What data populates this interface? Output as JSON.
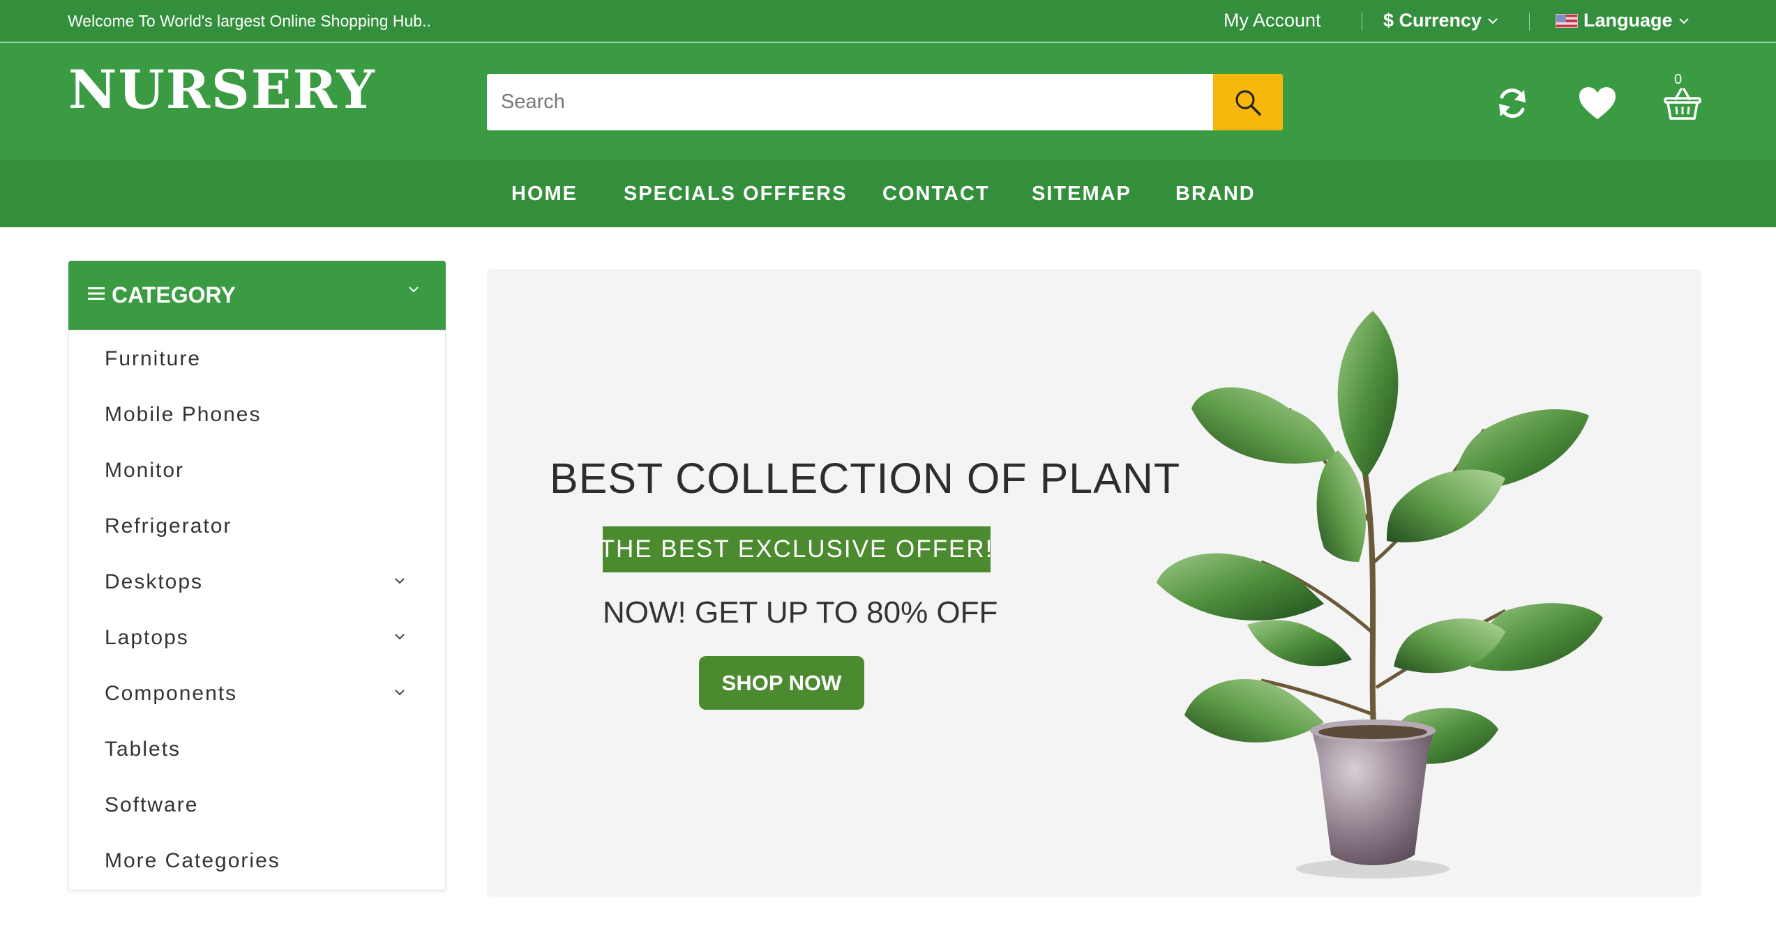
{
  "topbar": {
    "welcome": "Welcome To World's largest Online Shopping Hub..",
    "my_account": "My Account",
    "currency": "$ Currency",
    "language": "Language"
  },
  "header": {
    "logo": "NURSERY",
    "search_placeholder": "Search",
    "cart_count": "0"
  },
  "nav": {
    "items": [
      "HOME",
      "SPECIALS OFFFERS",
      "CONTACT",
      "SITEMAP",
      "BRAND"
    ]
  },
  "sidebar": {
    "title": "CATEGORY",
    "items": [
      {
        "label": "Furniture"
      },
      {
        "label": "Mobile Phones"
      },
      {
        "label": "Monitor"
      },
      {
        "label": "Refrigerator"
      },
      {
        "label": "Desktops",
        "has_submenu": true
      },
      {
        "label": "Laptops",
        "has_submenu": true
      },
      {
        "label": "Components",
        "has_submenu": true
      },
      {
        "label": "Tablets"
      },
      {
        "label": "Software"
      },
      {
        "label": "More Categories"
      }
    ]
  },
  "hero": {
    "title": "BEST COLLECTION OF PLANT",
    "badge": "THE BEST EXCLUSIVE OFFER!",
    "offer": "NOW! GET UP TO 80% OFF",
    "button": "SHOP NOW"
  },
  "colors": {
    "brand_green": "#3b9b43",
    "dark_green": "#338f3c",
    "accent_yellow": "#f7b70b",
    "banner_green": "#4c8a30"
  },
  "icons": [
    "chevron-down-icon",
    "flag-icon",
    "search-icon",
    "refresh-icon",
    "heart-icon",
    "basket-icon",
    "menu-icon",
    "plant-image"
  ]
}
